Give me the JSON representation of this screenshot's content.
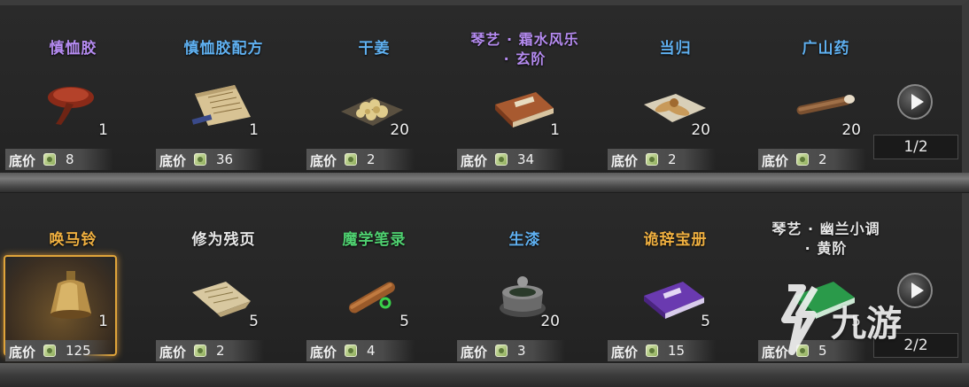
{
  "shelves": [
    {
      "items": [
        {
          "name": "慎恤胶",
          "name_color": "#b58bf0",
          "count": "1",
          "price_label": "底价",
          "price": "8",
          "icon": "lingzhi-mushroom-icon"
        },
        {
          "name": "慎恤胶配方",
          "name_color": "#5fb0f0",
          "count": "1",
          "price_label": "底价",
          "price": "36",
          "icon": "recipe-scroll-icon"
        },
        {
          "name": "干姜",
          "name_color": "#5fb0f0",
          "count": "20",
          "price_label": "底价",
          "price": "2",
          "icon": "dried-ginger-icon"
        },
        {
          "name": "琴艺 · 霜水风乐\n· 玄阶",
          "name_color": "#b58bf0",
          "count": "1",
          "price_label": "底价",
          "price": "34",
          "icon": "skill-book-icon"
        },
        {
          "name": "当归",
          "name_color": "#5fb0f0",
          "count": "20",
          "price_label": "底价",
          "price": "2",
          "icon": "angelica-root-icon"
        },
        {
          "name": "广山药",
          "name_color": "#5fb0f0",
          "count": "20",
          "price_label": "底价",
          "price": "2",
          "icon": "yam-root-icon"
        }
      ],
      "pager": "1/2"
    },
    {
      "items": [
        {
          "name": "唤马铃",
          "name_color": "#f0b040",
          "count": "1",
          "price_label": "底价",
          "price": "125",
          "icon": "bell-icon",
          "selected": true
        },
        {
          "name": "修为残页",
          "name_color": "#e8e8e8",
          "count": "5",
          "price_label": "底价",
          "price": "2",
          "icon": "torn-page-icon"
        },
        {
          "name": "魔学笔录",
          "name_color": "#4fd070",
          "count": "5",
          "price_label": "底价",
          "price": "4",
          "icon": "scroll-notes-icon"
        },
        {
          "name": "生漆",
          "name_color": "#5fb0f0",
          "count": "20",
          "price_label": "底价",
          "price": "3",
          "icon": "lacquer-pot-icon"
        },
        {
          "name": "诡辞宝册",
          "name_color": "#f0b040",
          "count": "5",
          "price_label": "底价",
          "price": "15",
          "icon": "purple-book-icon"
        },
        {
          "name": "琴艺 · 幽兰小调\n· 黄阶",
          "name_color": "#e8e8e8",
          "count": "5",
          "price_label": "底价",
          "price": "5",
          "icon": "green-book-icon"
        }
      ],
      "pager": "2/2"
    }
  ],
  "watermark": {
    "text": "九游",
    "icon": "jiuyou-logo-icon"
  }
}
